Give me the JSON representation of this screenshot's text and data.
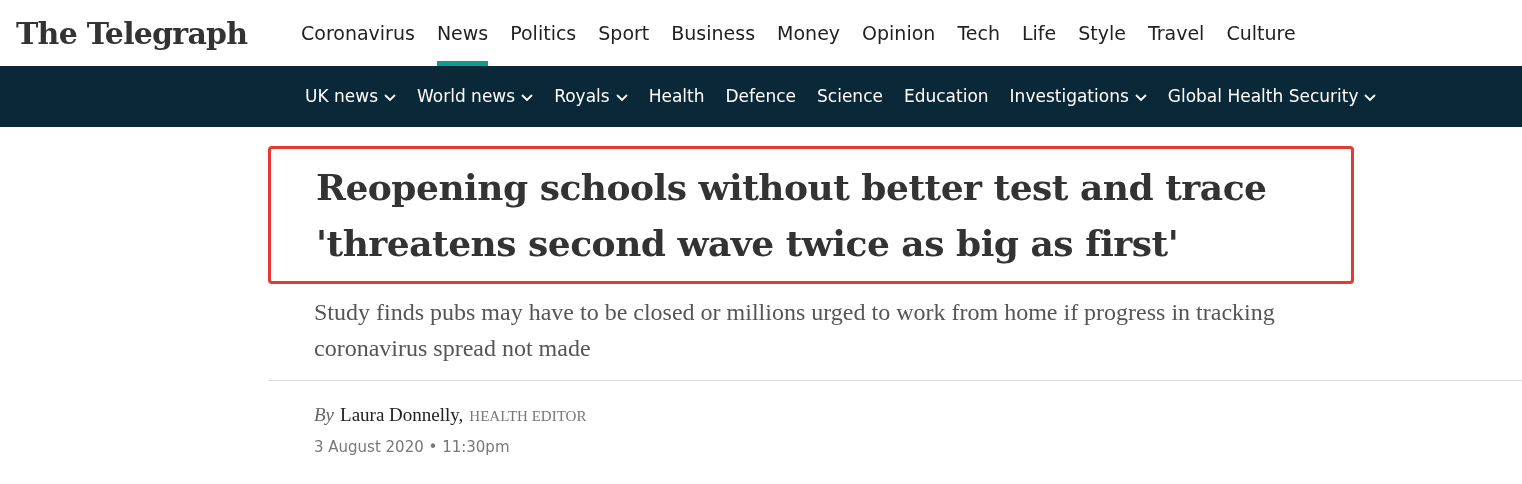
{
  "logo": "The Telegraph",
  "main_nav": [
    {
      "label": "Coronavirus",
      "selected": false
    },
    {
      "label": "News",
      "selected": true
    },
    {
      "label": "Politics",
      "selected": false
    },
    {
      "label": "Sport",
      "selected": false
    },
    {
      "label": "Business",
      "selected": false
    },
    {
      "label": "Money",
      "selected": false
    },
    {
      "label": "Opinion",
      "selected": false
    },
    {
      "label": "Tech",
      "selected": false
    },
    {
      "label": "Life",
      "selected": false
    },
    {
      "label": "Style",
      "selected": false
    },
    {
      "label": "Travel",
      "selected": false
    },
    {
      "label": "Culture",
      "selected": false
    }
  ],
  "sub_nav": [
    {
      "label": "UK news",
      "has_menu": true
    },
    {
      "label": "World news",
      "has_menu": true
    },
    {
      "label": "Royals",
      "has_menu": true
    },
    {
      "label": "Health",
      "has_menu": false
    },
    {
      "label": "Defence",
      "has_menu": false
    },
    {
      "label": "Science",
      "has_menu": false
    },
    {
      "label": "Education",
      "has_menu": false
    },
    {
      "label": "Investigations",
      "has_menu": true
    },
    {
      "label": "Global Health Security",
      "has_menu": true
    }
  ],
  "article": {
    "headline": "Reopening schools without better test and trace 'threatens second wave twice as big as first'",
    "highlighted": true,
    "standfirst": "Study finds pubs may have to be closed or millions urged to work from home if progress in tracking coronavirus spread not made",
    "byline": {
      "prefix": "By",
      "author": "Laura Donnelly,",
      "role": "HEALTH EDITOR"
    },
    "date": "3 August 2020 • 11:30pm"
  }
}
